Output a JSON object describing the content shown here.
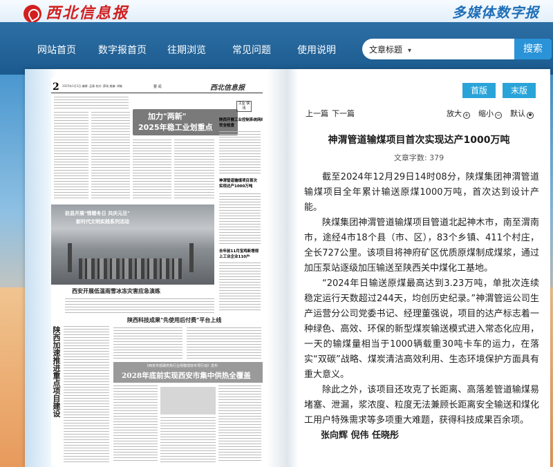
{
  "header": {
    "logo_text": "西北信息报",
    "brand_title": "多媒体数字报"
  },
  "nav": {
    "items": [
      "网站首页",
      "数字报首页",
      "往期浏览",
      "常见问题",
      "使用说明"
    ],
    "search": {
      "selected": "文章标题",
      "placeholder": "",
      "button": "搜索"
    }
  },
  "newspaper": {
    "page_no": "2",
    "meta": "2025年1月3日   编辑: 孟秦   校对: 薛瑞   美编: 胡敏",
    "edition": "要 闻",
    "masthead": "西北信息报",
    "headline_a": "加力\"两新\"",
    "headline_b": "2025年稳工业划重点",
    "side_label": "工业\n快讯",
    "side_title_1": "陕西开展工业控制系统网络安全检查",
    "side_title_2": "神渭管道输煤项目首次实现达产1000万吨",
    "side_title_3": "去年前11月宝鸡新增规上工业企业110户",
    "photo_cap_1": "驻县开展\"情暖冬日  共庆元旦\"",
    "photo_cap_2": "新时代文明实践系列活动",
    "caption": "西安开展低温雨雪冰冻灾害应急演练",
    "vertical_headline": "陕西加速推进重点项目建设",
    "headline_2": "陕西科技成果\"先使用后付费\"平台上线",
    "box_sub": "《西安市低碳供热行业规模增效专项行动》发布",
    "box_title": "2028年底前实现西安市集中供热全覆盖"
  },
  "reader": {
    "btn_first": "首版",
    "btn_last": "末版",
    "prev": "上一篇",
    "next": "下一篇",
    "zoom_in": "放大",
    "zoom_out": "缩小",
    "default": "默认",
    "title": "神渭管道输煤项目首次实现达产1000万吨",
    "word_count_label": "文章字数:",
    "word_count": "379",
    "paragraphs": [
      "截至2024年12月29日14时08分，陕煤集团神渭管道输煤项目全年累计输送原煤1000万吨，首次达到设计产能。",
      "陕煤集团神渭管道输煤项目管道北起神木市，南至渭南市，途经4市18个县（市、区），83个乡镇、411个村庄，全长727公里。该项目将神府矿区优质原煤制成煤浆，通过加压泵站逐级加压输送至陕西关中煤化工基地。",
      "“2024年日输送原煤最高达到3.23万吨，单批次连续稳定运行天数超过244天，均创历史纪录。”神渭管运公司生产运营分公司党委书记、经理董强说，项目的达产标志着一种绿色、高效、环保的新型煤炭输送模式进入常态化应用，一天的输煤量相当于1000辆载重30吨卡车的运力，在落实“双碳”战略、煤炭清洁高效利用、生态环境保护方面具有重大意义。",
      "除此之外，该项目还攻克了长距离、高落差管道输煤易堵塞、泄漏，浆浓度、粒度无法兼顾长距离安全输送和煤化工用户特殊需求等多项重大难题，获得科技成果百余项。"
    ],
    "author": "张向辉 倪伟 任晓彤"
  },
  "colors": {
    "nav_bg": "#1b5a8e",
    "accent": "#2aa4d8",
    "logo_red": "#d21f1f",
    "brand_blue": "#1f6fb8"
  }
}
